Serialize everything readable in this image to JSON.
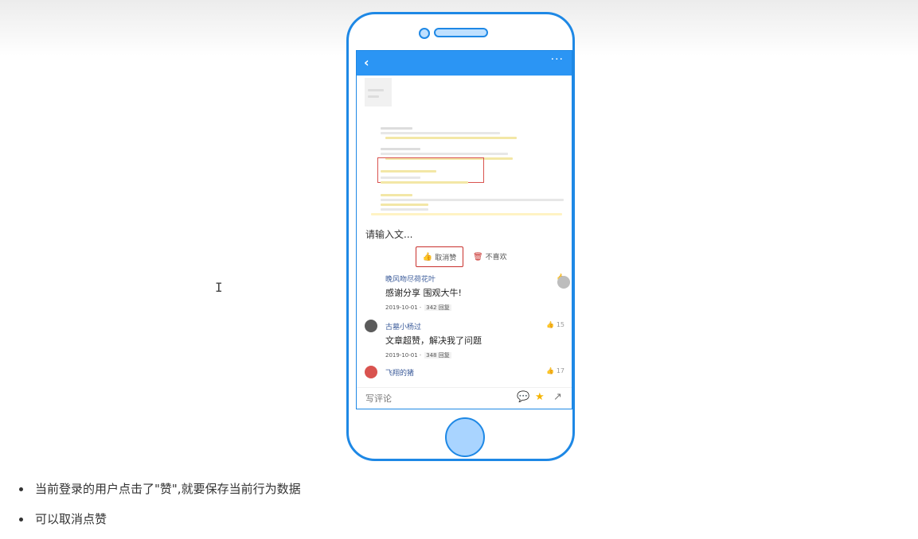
{
  "app": {
    "back_icon": "‹",
    "more_icon": "···",
    "input_hint": "请输入文...",
    "like_label": "取消赞",
    "dislike_label": "不喜欢"
  },
  "comments": [
    {
      "user": "晚风吻尽荷花叶",
      "likes": "",
      "text": "感谢分享 围观大牛!",
      "date": "2019-10-01 ·",
      "replies": "342 回复",
      "avatar_color": "#ffffff"
    },
    {
      "user": "古墓小杨过",
      "likes": "15",
      "text": "文章超赞，解决我了问题",
      "date": "2019-10-01 ·",
      "replies": "348 回复",
      "avatar_color": "#5b5b5b"
    },
    {
      "user": "飞翔的猪",
      "likes": "17",
      "text": "",
      "date": "",
      "replies": "",
      "avatar_color": "#d9534f"
    }
  ],
  "bottom_bar": {
    "write_comment": "写评论",
    "icons": [
      "comment-icon",
      "star-icon",
      "share-icon"
    ]
  },
  "bullets": [
    "当前登录的用户点击了\"赞\",就要保存当前行为数据",
    "可以取消点赞"
  ],
  "colors": {
    "brand_blue": "#2b95f4",
    "phone_outline": "#1e88e5",
    "like_red": "#c9302c",
    "star_yellow": "#f5b400"
  }
}
